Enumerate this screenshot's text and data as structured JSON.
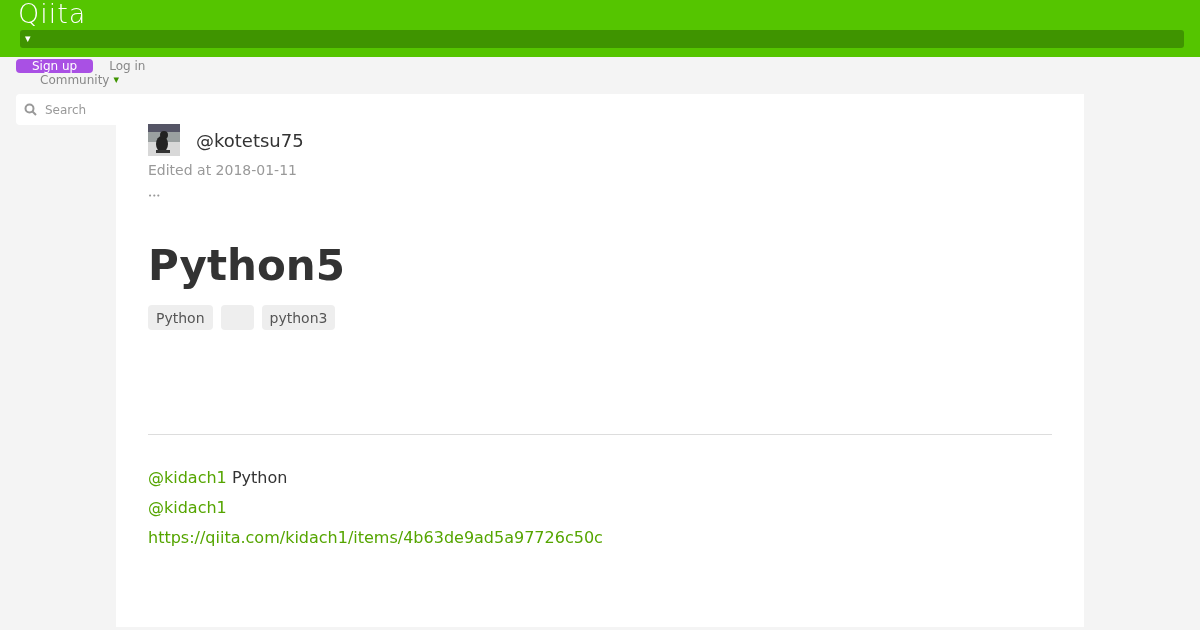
{
  "header": {
    "logo": "Qiita",
    "dropdown_caret": "▾"
  },
  "auth": {
    "signup": "Sign up",
    "login": "Log in",
    "community": "Community",
    "community_caret": "▾"
  },
  "search": {
    "placeholder": "Search"
  },
  "article": {
    "author": "@kotetsu75",
    "edited": "Edited at 2018-01-11",
    "more": "•••",
    "title": "Python5",
    "tags": [
      {
        "kind": "text",
        "label": "Python"
      },
      {
        "kind": "blank"
      },
      {
        "kind": "text",
        "label": "python3"
      }
    ],
    "body": [
      {
        "link": "@kidach1",
        "text": "Python"
      },
      {
        "link": "@kidach1"
      },
      {
        "link": "https://qiita.com/kidach1/items/4b63de9ad5a97726c50c"
      }
    ]
  }
}
